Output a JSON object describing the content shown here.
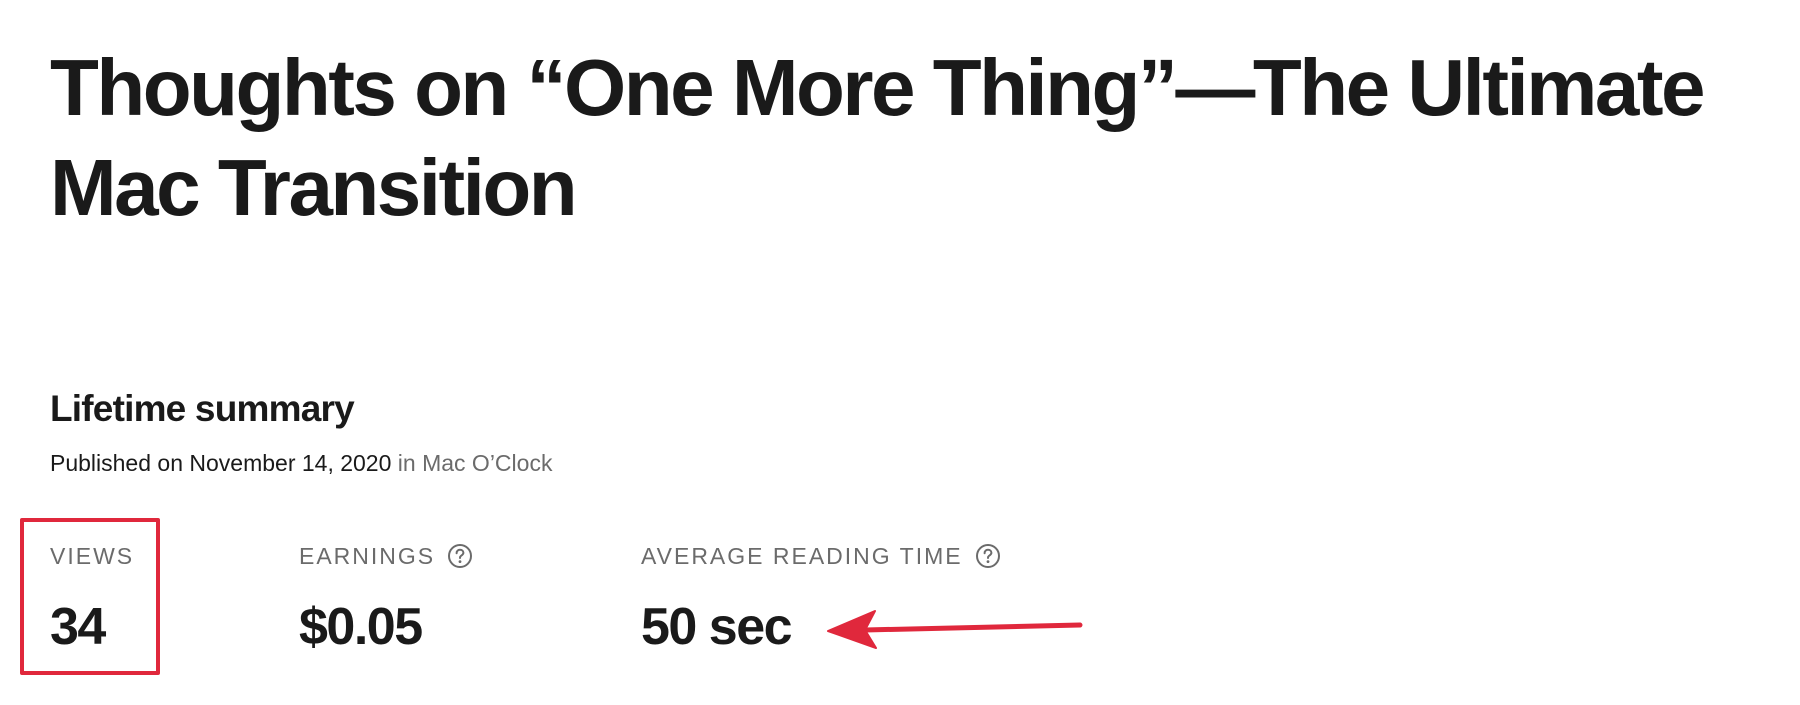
{
  "article": {
    "title": "Thoughts on “One More Thing”—The Ultimate Mac Transition"
  },
  "summary": {
    "heading": "Lifetime summary",
    "published_prefix": "Published on November 14, 2020",
    "published_in": " in ",
    "publication": "Mac O’Clock"
  },
  "stats": {
    "views": {
      "label": "VIEWS",
      "value": "34"
    },
    "earnings": {
      "label": "EARNINGS",
      "value": "$0.05",
      "icon": "help-circle-icon"
    },
    "reading_time": {
      "label": "AVERAGE READING TIME",
      "value": "50 sec",
      "icon": "help-circle-icon"
    }
  },
  "annotations": {
    "highlight_color": "#e0283c",
    "arrow_color": "#e0283c"
  }
}
